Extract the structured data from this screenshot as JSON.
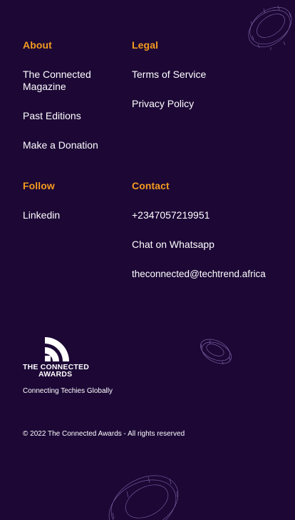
{
  "colors": {
    "background": "#1c0735",
    "heading": "#f59b1e",
    "text": "#ffffff",
    "ring_stroke": "#8a6fb5"
  },
  "sections": {
    "about": {
      "heading": "About",
      "links": [
        "The Connected Magazine",
        "Past Editions",
        "Make a Donation"
      ]
    },
    "legal": {
      "heading": "Legal",
      "links": [
        "Terms of Service",
        "Privacy Policy"
      ]
    },
    "follow": {
      "heading": "Follow",
      "links": [
        "Linkedin"
      ]
    },
    "contact": {
      "heading": "Contact",
      "links": [
        "+2347057219951",
        "Chat on Whatsapp",
        "theconnected@techtrend.africa"
      ]
    }
  },
  "brand": {
    "logo_line1": "THE CONNECTED",
    "logo_line2": "AWARDS",
    "tagline": "Connecting Techies Globally",
    "logo_icon": "signal-waves-icon",
    "decor_icon": "wireframe-ring-icon"
  },
  "copyright": "© 2022 The Connected Awards - All rights reserved"
}
